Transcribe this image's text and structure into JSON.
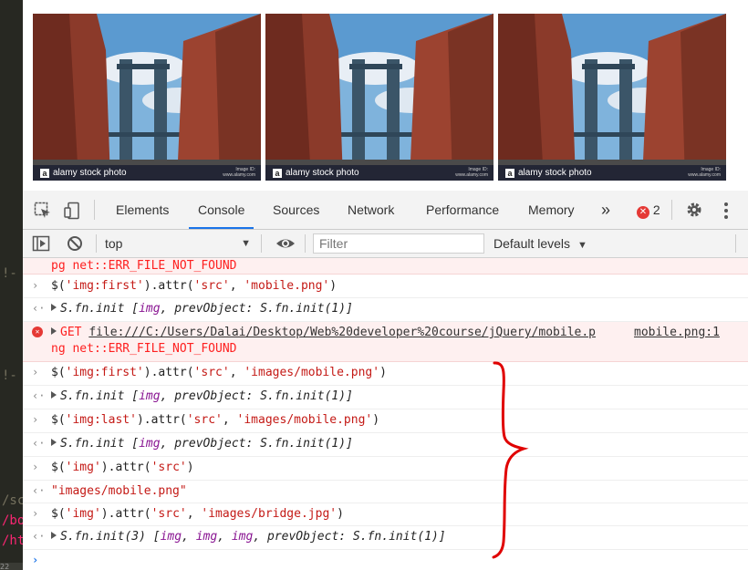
{
  "editor": {
    "fragments": [
      "!-",
      "!-",
      "/sc",
      "/bo",
      "/ht",
      "22"
    ]
  },
  "page": {
    "photos": [
      {
        "watermark": "alamy stock photo",
        "small": "Image ID: ",
        "small2": "www.alamy.com"
      },
      {
        "watermark": "alamy stock photo",
        "small": "Image ID: ",
        "small2": "www.alamy.com"
      },
      {
        "watermark": "alamy stock photo",
        "small": "Image ID: ",
        "small2": "www.alamy.com"
      }
    ]
  },
  "devtools": {
    "tabs": [
      "Elements",
      "Console",
      "Sources",
      "Network",
      "Performance",
      "Memory"
    ],
    "active_tab": "Console",
    "more_tabs": "»",
    "error_count": "2",
    "toolbar": {
      "context": "top",
      "filter_placeholder": "Filter",
      "levels": "Default levels"
    },
    "console": {
      "rows": [
        {
          "kind": "error-tail",
          "text": "pg net::ERR_FILE_NOT_FOUND"
        },
        {
          "kind": "input",
          "pre": "$(",
          "s1": "'img:first'",
          "mid": ").attr(",
          "s2": "'src'",
          "comma": ", ",
          "s3": "'mobile.png'",
          "post": ")"
        },
        {
          "kind": "output",
          "a": "S.fn.init [",
          "b": "img",
          "c": ", ",
          "d": "prevObject",
          "e": ": S.fn.init(1)]"
        },
        {
          "kind": "error",
          "get": "GET ",
          "url": "file:///C:/Users/Dalai/Desktop/Web%20developer%20course/jQuery/mobile.p",
          "src": "mobile.png:1",
          "tail": "ng net::ERR_FILE_NOT_FOUND"
        },
        {
          "kind": "input",
          "pre": "$(",
          "s1": "'img:first'",
          "mid": ").attr(",
          "s2": "'src'",
          "comma": ", ",
          "s3": "'images/mobile.png'",
          "post": ")"
        },
        {
          "kind": "output",
          "a": "S.fn.init [",
          "b": "img",
          "c": ", ",
          "d": "prevObject",
          "e": ": S.fn.init(1)]"
        },
        {
          "kind": "input",
          "pre": "$(",
          "s1": "'img:last'",
          "mid": ").attr(",
          "s2": "'src'",
          "comma": ", ",
          "s3": "'images/mobile.png'",
          "post": ")"
        },
        {
          "kind": "output",
          "a": "S.fn.init [",
          "b": "img",
          "c": ", ",
          "d": "prevObject",
          "e": ": S.fn.init(1)]"
        },
        {
          "kind": "input2",
          "pre": "$(",
          "s1": "'img'",
          "mid": ").attr(",
          "s2": "'src'",
          "post": ")"
        },
        {
          "kind": "result",
          "text": "\"images/mobile.png\""
        },
        {
          "kind": "input",
          "pre": "$(",
          "s1": "'img'",
          "mid": ").attr(",
          "s2": "'src'",
          "comma": ", ",
          "s3": "'images/bridge.jpg'",
          "post": ")"
        },
        {
          "kind": "output3",
          "a": "S.fn.init(3) [",
          "b": "img",
          "c": ", ",
          "b2": "img",
          "c2": ", ",
          "b3": "img",
          "c3": ", ",
          "d": "prevObject",
          "e": ": S.fn.init(1)]"
        }
      ],
      "prompt": "›"
    }
  },
  "colors": {
    "string": "#c41a16",
    "property": "#881391",
    "error_bg": "#fef0f0",
    "error_text": "#fe2020",
    "accent": "#1a73e8",
    "annotation": "#e00000"
  }
}
